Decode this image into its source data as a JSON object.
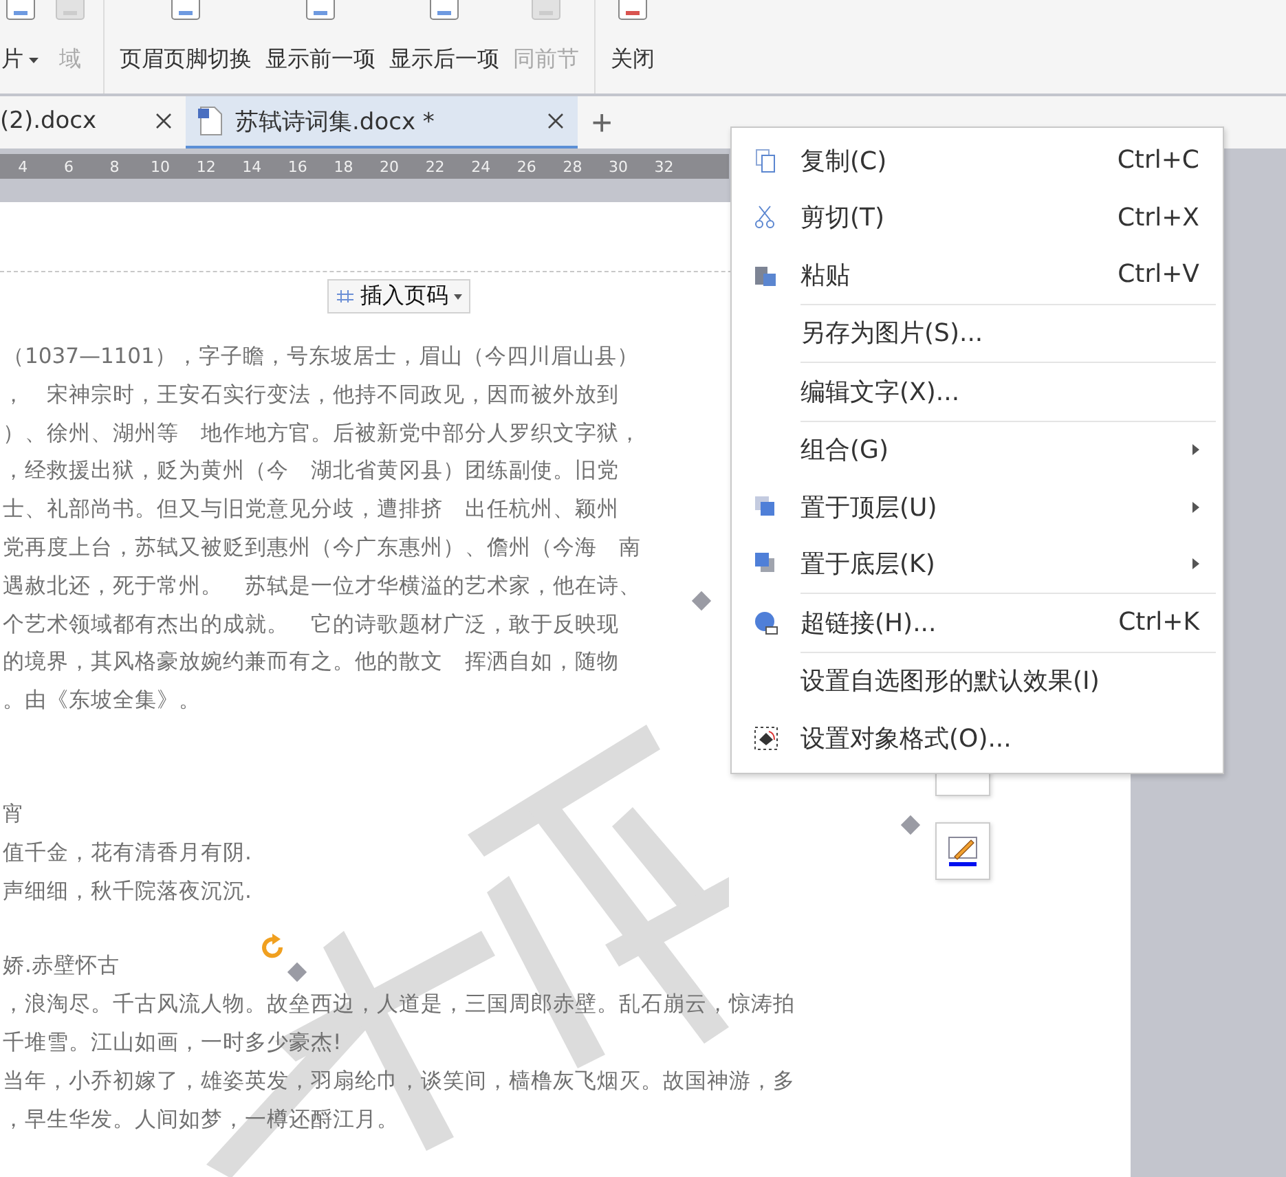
{
  "toolbar": [
    {
      "label": "片",
      "dropdown": true,
      "disabled": false,
      "separator_before": false
    },
    {
      "label": "域",
      "dropdown": false,
      "disabled": true,
      "separator_before": false
    },
    {
      "label": "页眉页脚切换",
      "dropdown": false,
      "disabled": false,
      "separator_before": true
    },
    {
      "label": "显示前一项",
      "dropdown": false,
      "disabled": false,
      "separator_before": false
    },
    {
      "label": "显示后一项",
      "dropdown": false,
      "disabled": false,
      "separator_before": false
    },
    {
      "label": "同前节",
      "dropdown": false,
      "disabled": true,
      "separator_before": false
    },
    {
      "label": "关闭",
      "dropdown": false,
      "disabled": false,
      "separator_before": true
    }
  ],
  "tabs": [
    {
      "label": "(2).docx",
      "selected": false
    },
    {
      "label": "苏轼诗词集.docx *",
      "selected": true
    }
  ],
  "new_tab": "+",
  "ruler": [
    "4",
    "6",
    "8",
    "10",
    "12",
    "14",
    "16",
    "18",
    "20",
    "22",
    "24",
    "26",
    "28",
    "30",
    "32"
  ],
  "header": {
    "insert_page_number": "插入页码"
  },
  "document": [
    {
      "lines": [
        "（1037—1101），字子瞻，号东坡居士，眉山（今四川眉山县）",
        "，　宋神宗时，王安石实行变法，他持不同政见，因而被外放到",
        "）、徐州、湖州等　地作地方官。后被新党中部分人罗织文字狱，",
        "，经救援出狱，贬为黄州（今　湖北省黄冈县）团练副使。旧党",
        "士、礼部尚书。但又与旧党意见分歧，遭排挤　出任杭州、颖州",
        "党再度上台，苏轼又被贬到惠州（今广东惠州）、儋州（今海　南",
        "遇赦北还，死于常州。　苏轼是一位才华横溢的艺术家，他在诗、",
        "个艺术领域都有杰出的成就。　它的诗歌题材广泛，敢于反映现",
        "的境界，其风格豪放婉约兼而有之。他的散文　挥洒自如，随物",
        "。由《东坡全集》。"
      ]
    },
    {
      "lines": [
        "宵",
        "值千金，花有清香月有阴.",
        "声细细，秋千院落夜沉沉."
      ]
    },
    {
      "lines": [
        "娇.赤壁怀古",
        "，浪淘尽。千古风流人物。故垒西边，人道是，三国周郎赤壁。乱石崩云，惊涛拍",
        "千堆雪。江山如画，一时多少豪杰!",
        "当年，小乔初嫁了，雄姿英发，羽扇纶巾，谈笑间，樯橹灰飞烟灭。故国神游，多",
        "，早生华发。人间如梦，一樽还酹江月。"
      ]
    }
  ],
  "context_menu": [
    {
      "label": "复制(C)",
      "shortcut": "Ctrl+C",
      "submenu": false,
      "separator_before": false
    },
    {
      "label": "剪切(T)",
      "shortcut": "Ctrl+X",
      "submenu": false,
      "separator_before": false
    },
    {
      "label": "粘贴",
      "shortcut": "Ctrl+V",
      "submenu": false,
      "separator_before": false
    },
    {
      "label": "另存为图片(S)...",
      "submenu": false,
      "separator_before": true
    },
    {
      "label": "编辑文字(X)...",
      "submenu": false,
      "separator_before": true
    },
    {
      "label": "组合(G)",
      "submenu": true,
      "separator_before": true
    },
    {
      "label": "置于顶层(U)",
      "submenu": true,
      "separator_before": false
    },
    {
      "label": "置于底层(K)",
      "submenu": true,
      "separator_before": false
    },
    {
      "label": "超链接(H)...",
      "shortcut": "Ctrl+K",
      "submenu": false,
      "separator_before": true
    },
    {
      "label": "设置自选图形的默认效果(I)",
      "submenu": false,
      "separator_before": true
    },
    {
      "label": "设置对象格式(O)...",
      "submenu": false,
      "separator_before": false
    }
  ]
}
